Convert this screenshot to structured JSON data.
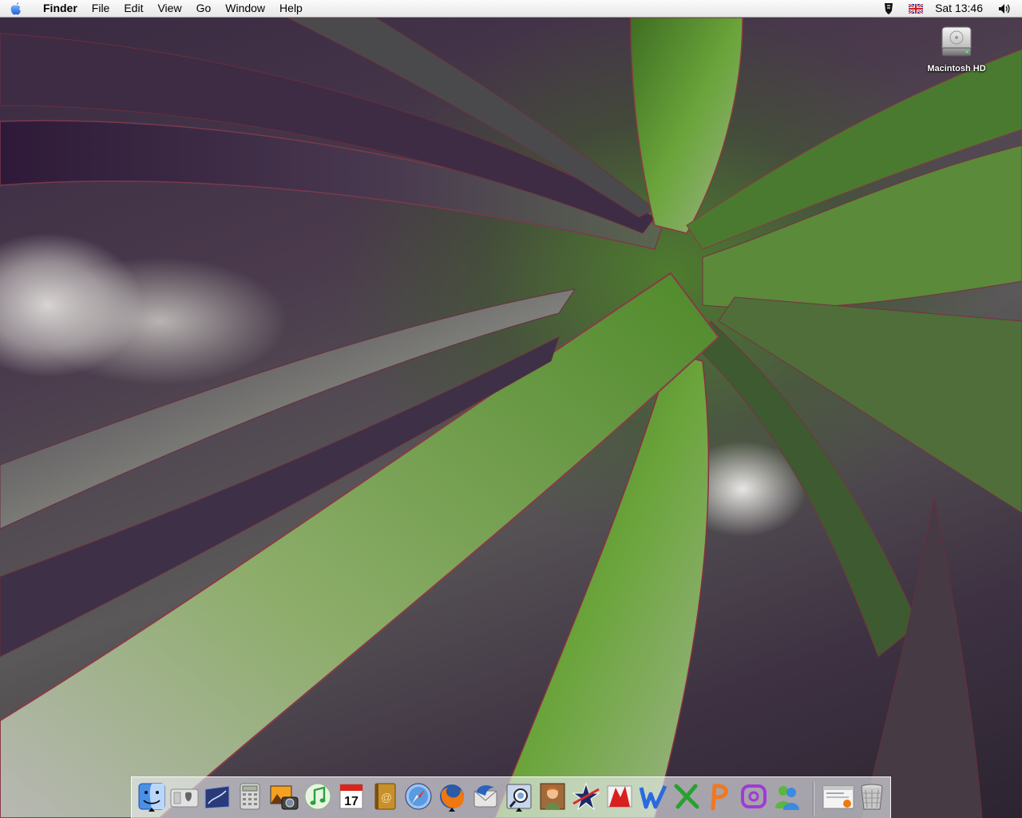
{
  "menubar": {
    "apple_icon": "apple-icon",
    "app_name": "Finder",
    "menus": [
      "File",
      "Edit",
      "View",
      "Go",
      "Window",
      "Help"
    ],
    "status": {
      "script_icon": "script-menu-icon",
      "input_flag_icon": "uk-flag-icon",
      "clock": "Sat 13:46",
      "volume_icon": "volume-icon"
    }
  },
  "desktop": {
    "icons": [
      {
        "label": "Macintosh HD",
        "icon": "hard-drive-icon"
      }
    ]
  },
  "dock": {
    "apps": [
      {
        "icon": "finder-icon",
        "running": true
      },
      {
        "icon": "system-profiler-icon",
        "running": false
      },
      {
        "icon": "grapher-icon",
        "running": false
      },
      {
        "icon": "calculator-icon",
        "running": false
      },
      {
        "icon": "iphoto-icon",
        "running": false
      },
      {
        "icon": "itunes-icon",
        "running": false
      },
      {
        "icon": "ical-icon",
        "calendar_day": "17",
        "running": false
      },
      {
        "icon": "address-book-icon",
        "running": false
      },
      {
        "icon": "safari-icon",
        "running": false
      },
      {
        "icon": "firefox-icon",
        "running": true
      },
      {
        "icon": "thunderbird-icon",
        "running": false
      },
      {
        "icon": "preview-icon",
        "running": true
      },
      {
        "icon": "portrait-app-icon",
        "running": false
      },
      {
        "icon": "star-app-icon",
        "running": false
      },
      {
        "icon": "red-box-app-icon",
        "running": false
      },
      {
        "icon": "word-icon",
        "running": false
      },
      {
        "icon": "excel-icon",
        "running": false
      },
      {
        "icon": "powerpoint-icon",
        "running": false
      },
      {
        "icon": "entourage-icon",
        "running": false
      },
      {
        "icon": "messenger-icon",
        "running": false
      }
    ],
    "minimized": [
      {
        "icon": "minimized-firefox-window-icon"
      },
      {
        "icon": "trash-icon"
      }
    ]
  }
}
